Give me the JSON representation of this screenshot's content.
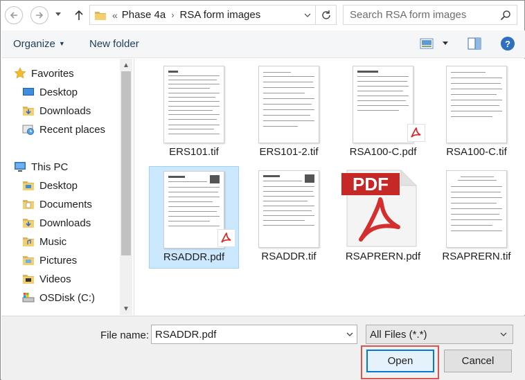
{
  "nav": {
    "back_icon": "back-arrow-icon",
    "forward_icon": "forward-arrow-icon",
    "up_icon": "up-arrow-icon"
  },
  "address": {
    "overflow": "«",
    "crumbs": [
      "Phase 4a",
      "RSA form images"
    ],
    "refresh_icon": "refresh-icon"
  },
  "search": {
    "placeholder": "Search RSA form images"
  },
  "toolbar": {
    "organize": "Organize",
    "new_folder": "New folder"
  },
  "sidebar": {
    "favorites_header": "Favorites",
    "favorites": [
      {
        "label": "Desktop",
        "icon": "desktop-icon"
      },
      {
        "label": "Downloads",
        "icon": "downloads-icon"
      },
      {
        "label": "Recent places",
        "icon": "recent-places-icon"
      }
    ],
    "thispc_header": "This PC",
    "thispc": [
      {
        "label": "Desktop",
        "icon": "desktop-icon"
      },
      {
        "label": "Documents",
        "icon": "documents-icon"
      },
      {
        "label": "Downloads",
        "icon": "downloads-icon"
      },
      {
        "label": "Music",
        "icon": "music-icon"
      },
      {
        "label": "Pictures",
        "icon": "pictures-icon"
      },
      {
        "label": "Videos",
        "icon": "videos-icon"
      },
      {
        "label": "OSDisk (C:)",
        "icon": "drive-icon"
      }
    ]
  },
  "files": [
    {
      "name": "ERS101.tif",
      "type": "tif",
      "selected": false
    },
    {
      "name": "ERS101-2.tif",
      "type": "tif",
      "selected": false
    },
    {
      "name": "RSA100-C.pdf",
      "type": "pdf",
      "selected": false
    },
    {
      "name": "RSA100-C.tif",
      "type": "tif",
      "selected": false
    },
    {
      "name": "RSADDR.pdf",
      "type": "pdf",
      "selected": true
    },
    {
      "name": "RSADDR.tif",
      "type": "tif",
      "selected": false
    },
    {
      "name": "RSAPRERN.pdf",
      "type": "pdf-icon",
      "selected": false
    },
    {
      "name": "RSAPRERN.tif",
      "type": "tif",
      "selected": false
    }
  ],
  "bottom": {
    "file_name_label": "File name:",
    "file_name_value": "RSADDR.pdf",
    "file_type": "All Files (*.*)",
    "open": "Open",
    "cancel": "Cancel"
  },
  "colors": {
    "selection": "#cce8ff",
    "accent": "#0078d7",
    "highlight": "#d9534f",
    "pdf_red": "#d32f2f"
  }
}
